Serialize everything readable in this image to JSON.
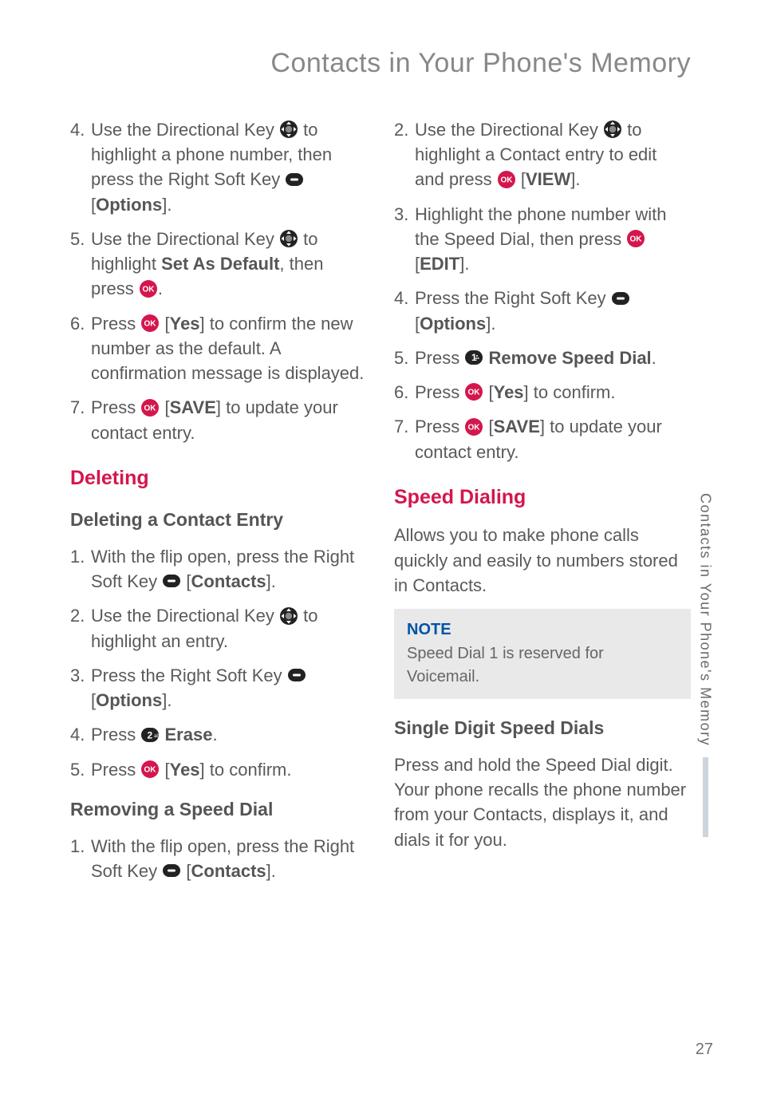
{
  "title": "Contacts in Your Phone's Memory",
  "sideTab": "Contacts in Your Phone's Memory",
  "pageNumber": "27",
  "left": {
    "steps1": {
      "s4a": "Use the Directional Key ",
      "s4b": " to highlight a phone number, then press the Right Soft Key ",
      "s4c": " [",
      "s4opt": "Options",
      "s4d": "].",
      "s5a": "Use the Directional Key ",
      "s5b": " to highlight ",
      "s5bold": "Set As Default",
      "s5c": ", then press ",
      "s5d": ".",
      "s6a": "Press ",
      "s6b": " [",
      "s6yes": "Yes",
      "s6c": "] to confirm the new number as the default. A confirmation message is displayed.",
      "s7a": "Press ",
      "s7b": " [",
      "s7save": "SAVE",
      "s7c": "] to update your contact entry."
    },
    "deleting": "Deleting",
    "delEntry": "Deleting a Contact Entry",
    "delSteps": {
      "s1a": "With the flip open, press the Right Soft Key ",
      "s1b": " [",
      "s1c": "Contacts",
      "s1d": "].",
      "s2a": "Use the Directional Key ",
      "s2b": " to highlight an entry.",
      "s3a": "Press the Right Soft Key ",
      "s3b": " [",
      "s3c": "Options",
      "s3d": "].",
      "s4a": "Press ",
      "s4b": " ",
      "s4erase": "Erase",
      "s4c": ".",
      "s5a": "Press ",
      "s5b": " [",
      "s5yes": "Yes",
      "s5c": "] to confirm."
    },
    "removing": "Removing a Speed Dial",
    "remSteps": {
      "s1a": "With the flip open, press the Right Soft Key ",
      "s1b": " [",
      "s1c": "Contacts",
      "s1d": "]."
    }
  },
  "right": {
    "remCont": {
      "s2a": "Use the Directional Key ",
      "s2b": " to highlight a Contact entry to edit and press ",
      "s2c": " [",
      "s2view": "VIEW",
      "s2d": "].",
      "s3a": "Highlight the phone number with the Speed Dial, then press ",
      "s3b": " [",
      "s3edit": "EDIT",
      "s3c": "].",
      "s4a": "Press the Right Soft Key ",
      "s4b": " [",
      "s4opt": "Options",
      "s4c": "].",
      "s5a": "Press ",
      "s5b": " ",
      "s5rem": "Remove Speed Dial",
      "s5c": ".",
      "s6a": "Press ",
      "s6b": " [",
      "s6yes": "Yes",
      "s6c": "] to confirm.",
      "s7a": "Press ",
      "s7b": " [",
      "s7save": "SAVE",
      "s7c": "] to update your contact entry."
    },
    "speed": "Speed Dialing",
    "speedPara": "Allows you to make phone calls quickly and easily to numbers stored in Contacts.",
    "noteTitle": "NOTE",
    "noteBody": "Speed Dial 1 is reserved for Voicemail.",
    "single": "Single Digit Speed Dials",
    "singlePara": "Press and hold the Speed Dial digit. Your phone recalls the phone number from your Contacts, displays it, and dials it for you."
  }
}
